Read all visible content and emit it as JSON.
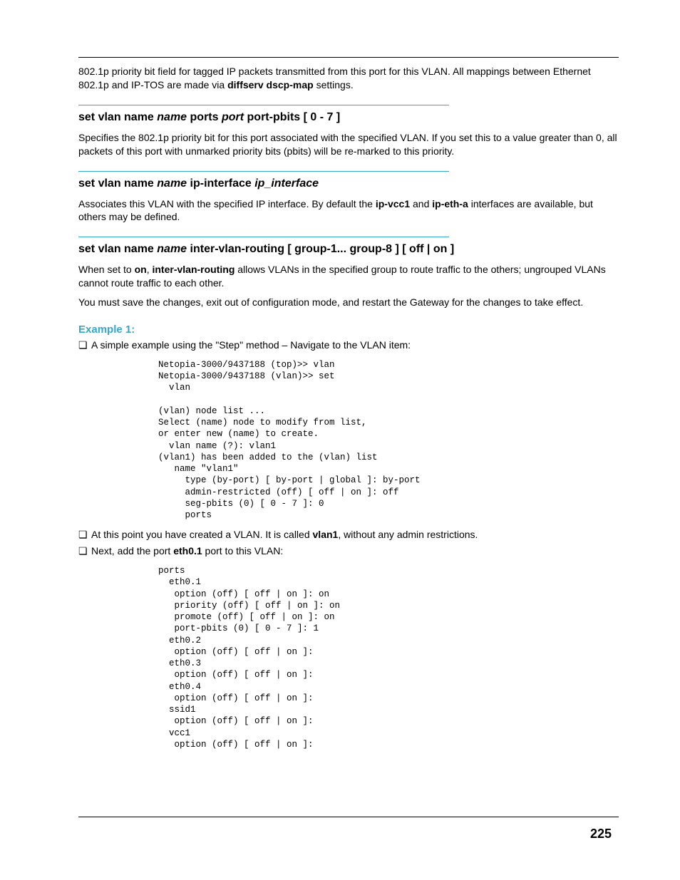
{
  "intro": {
    "p1_a": "802.1p priority bit field for tagged IP packets transmitted from this port for this VLAN. All mappings between Ethernet 802.1p and IP-TOS are made via ",
    "p1_bold": "diffserv dscp-map",
    "p1_b": " settings."
  },
  "sec1": {
    "h_a": "set vlan name ",
    "h_ital1": "name",
    "h_b": " ports ",
    "h_ital2": "port",
    "h_c": " port-pbits [ 0 - 7 ]",
    "body": "Specifies the 802.1p priority bit for this port associated with the specified VLAN. If you set this to a value greater than 0, all packets of this port with unmarked priority bits (pbits) will be re-marked to this priority."
  },
  "sec2": {
    "h_a": "set vlan name ",
    "h_ital1": "name",
    "h_b": " ip-interface ",
    "h_ital2": "ip_interface",
    "body_a": "Associates this VLAN with the specified IP interface. By default the ",
    "body_bold1": "ip-vcc1",
    "body_b": " and ",
    "body_bold2": "ip-eth-a",
    "body_c": " interfaces are available, but others may be defined."
  },
  "sec3": {
    "h_a": "set vlan name ",
    "h_ital1": "name",
    "h_b": " inter-vlan-routing [ group-1... group-8 ] [ off | on ]",
    "p1_a": "When set to ",
    "p1_bold1": "on",
    "p1_b": ", ",
    "p1_bold2": "inter-vlan-routing",
    "p1_c": " allows VLANs in the specified group to route traffic to the others; ungrouped VLANs cannot route traffic to each other.",
    "p2": "You must save the changes, exit out of configuration mode, and restart the Gateway for the changes to take effect."
  },
  "example": {
    "title": "Example 1:",
    "b1": "A simple example using the \"Step\" method – Navigate to the VLAN item:",
    "code1": "Netopia-3000/9437188 (top)>> vlan\nNetopia-3000/9437188 (vlan)>> set\n  vlan\n\n(vlan) node list ...\nSelect (name) node to modify from list,\nor enter new (name) to create.\n  vlan name (?): vlan1\n(vlan1) has been added to the (vlan) list\n   name \"vlan1\"\n     type (by-port) [ by-port | global ]: by-port\n     admin-restricted (off) [ off | on ]: off\n     seg-pbits (0) [ 0 - 7 ]: 0\n     ports",
    "b2_a": "At this point you have created a VLAN. It is called ",
    "b2_bold": "vlan1",
    "b2_b": ", without any admin restrictions.",
    "b3_a": "Next, add the port ",
    "b3_bold": "eth0.1",
    "b3_b": " port to this VLAN:",
    "code2": "ports\n  eth0.1\n   option (off) [ off | on ]: on\n   priority (off) [ off | on ]: on\n   promote (off) [ off | on ]: on\n   port-pbits (0) [ 0 - 7 ]: 1\n  eth0.2\n   option (off) [ off | on ]:\n  eth0.3\n   option (off) [ off | on ]:\n  eth0.4\n   option (off) [ off | on ]:\n  ssid1\n   option (off) [ off | on ]:\n  vcc1\n   option (off) [ off | on ]:"
  },
  "page_number": "225"
}
